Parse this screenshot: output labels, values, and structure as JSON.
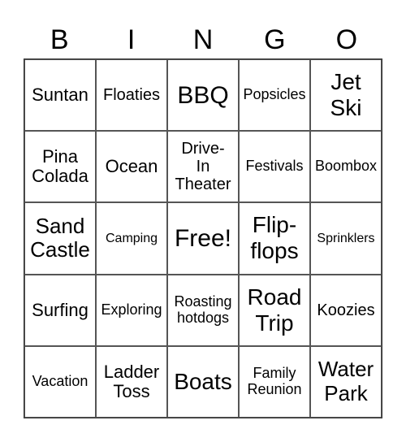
{
  "header": [
    "B",
    "I",
    "N",
    "G",
    "O"
  ],
  "cells": [
    "Suntan",
    "Floaties",
    "BBQ",
    "Popsicles",
    "Jet Ski",
    "Pina Colada",
    "Ocean",
    "Drive-In Theater",
    "Festivals",
    "Boombox",
    "Sand Castle",
    "Camping",
    "Free!",
    "Flip-flops",
    "Sprinklers",
    "Surfing",
    "Exploring",
    "Roasting hotdogs",
    "Road Trip",
    "Koozies",
    "Vacation",
    "Ladder Toss",
    "Boats",
    "Family Reunion",
    "Water Park"
  ]
}
